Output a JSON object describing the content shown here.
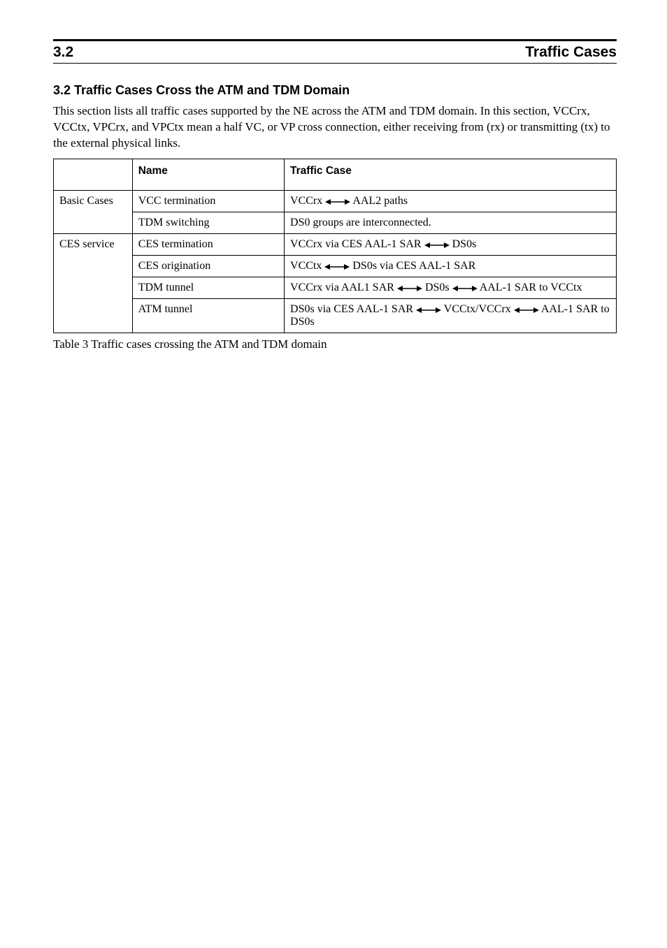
{
  "header": {
    "section": "3.2",
    "title": "Traffic Cases"
  },
  "h3": "3.2 Traffic Cases Cross the ATM and TDM Domain",
  "intro": "This section lists all traffic cases supported by the NE across the ATM and TDM domain. In this section, VCCrx, VCCtx, VPCrx, and VPCtx mean a half VC, or VP cross connection, either receiving from (rx) or transmitting (tx) to the external physical links.",
  "table": {
    "headers": [
      "",
      "Name",
      "Traffic Case"
    ],
    "rows": [
      {
        "cat_label": "Basic Cases",
        "cat_rowspan": 2,
        "name": "VCC termination",
        "before": "VCCrx ",
        "after": " AAL2 paths",
        "arrows": 1
      },
      {
        "name": "TDM switching",
        "before": "DS0 groups are interconnected.",
        "after": "",
        "arrows": 0
      },
      {
        "cat_label": "CES service",
        "cat_rowspan": 4,
        "name": "CES termination",
        "before": "VCCrx via CES AAL-1 SAR ",
        "after": " DS0s",
        "arrows": 1
      },
      {
        "name": "CES origination",
        "before": "VCCtx ",
        "after": " DS0s via CES AAL-1 SAR",
        "arrows": 1
      },
      {
        "name": "TDM tunnel",
        "before": "VCCrx via AAL1 SAR ",
        "mid": " DS0s ",
        "after": " AAL-1 SAR to VCCtx",
        "arrows": 2
      },
      {
        "name": "ATM tunnel",
        "before": "DS0s via CES AAL-1 SAR ",
        "mid": " VCCtx/VCCrx ",
        "after": " AAL-1 SAR to DS0s",
        "arrows": 2
      }
    ],
    "caption": "Table 3  Traffic cases crossing the ATM and TDM domain"
  }
}
